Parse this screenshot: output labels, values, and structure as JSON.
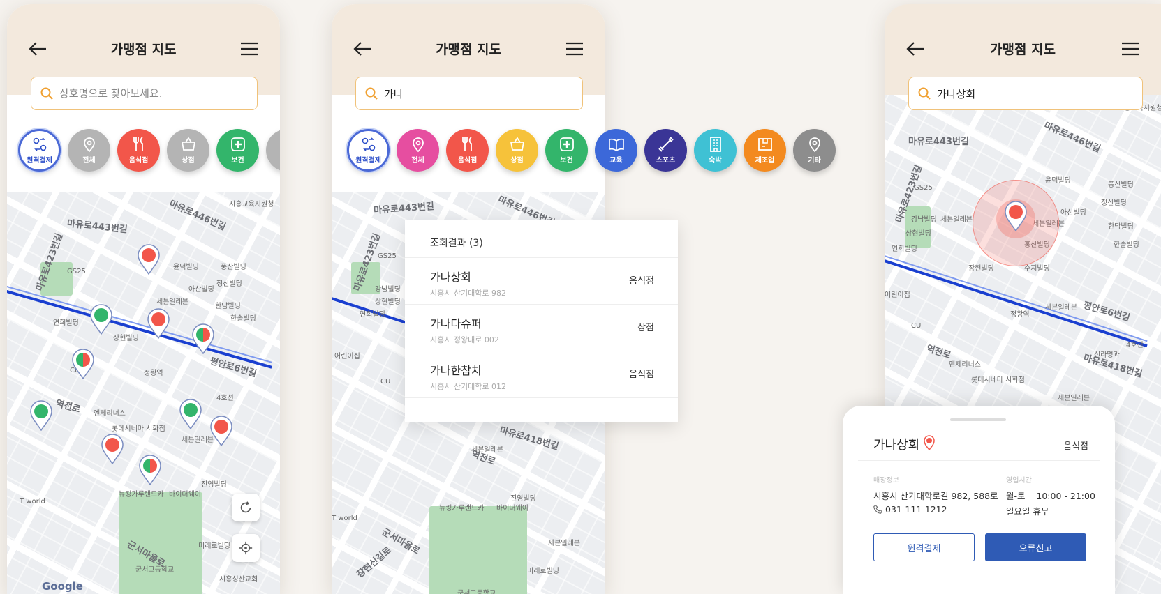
{
  "app": {
    "title": "가맹점 지도",
    "search_placeholder": "상호명으로 찾아보세요.",
    "search_query_results": "가나",
    "search_query_selected": "가나상회"
  },
  "categories": [
    {
      "label": "원격결제",
      "color": "#ffffff",
      "icon": "remote-payment-icon"
    },
    {
      "label": "전체",
      "color": "#b4b4b4",
      "icon": "location-pin-icon"
    },
    {
      "label": "음식점",
      "color": "#f2564a",
      "icon": "fork-knife-icon"
    },
    {
      "label": "상점",
      "color": "#f6c23a",
      "icon": "shopping-basket-icon"
    },
    {
      "label": "보건",
      "color": "#33b56b",
      "icon": "medical-plus-icon"
    },
    {
      "label": "교육",
      "color": "#3c68d9",
      "icon": "book-icon"
    },
    {
      "label": "스포츠",
      "color": "#3a3596",
      "icon": "dumbbell-icon"
    },
    {
      "label": "숙박",
      "color": "#3fc1d4",
      "icon": "hotel-icon"
    },
    {
      "label": "제조업",
      "color": "#f38a1f",
      "icon": "box-icon"
    },
    {
      "label": "기타",
      "color": "#8d8d8d",
      "icon": "map-pin-icon"
    }
  ],
  "map_labels": {
    "road_1": "마유로443번길",
    "road_2": "마유로446번길",
    "road_3": "평안로6번길",
    "road_4": "역전로",
    "road_5": "마유로423번길",
    "road_6": "마유로418번길",
    "road_7": "군서마을로",
    "road_8": "장현신길로",
    "store_gs25": "GS25",
    "store_cu": "CU",
    "seven": "세븐일레븐",
    "bldg_1": "윤덕빌딩",
    "bldg_2": "풍산빌딩",
    "bldg_3": "아산빌딩",
    "bldg_4": "정산빌딩",
    "bldg_5": "한담빌딩",
    "bldg_6": "한솔빌딩",
    "bldg_7": "강남빌딩",
    "bldg_8": "상현빌딩",
    "bldg_9": "연희빌딩",
    "bldg_10": "장현빌딩",
    "bldg_11": "수지빌딩",
    "bldg_12": "홍산빌딩",
    "station": "정왕역",
    "theater": "롯데시네마 시화점",
    "cafe": "엔제리너스",
    "sinrak": "신라명과",
    "school": "군서고등학교",
    "church": "시흥성산교회",
    "edu": "시흥교육지원청",
    "daycare": "어린이집",
    "tworld": "T world",
    "newcar": "뉴킹가루랜드카",
    "bike": "바이더웨이",
    "mirae": "미래로빌딩",
    "jinyoung": "진영빌딩",
    "line_4": "4호선",
    "google": "Google"
  },
  "results": {
    "header": "조회결과 (3)",
    "items": [
      {
        "name": "가나상회",
        "address": "시흥시 산기대학로 982",
        "category": "음식점"
      },
      {
        "name": "가나다슈퍼",
        "address": "시흥시 정왕대로 002",
        "category": "상점"
      },
      {
        "name": "가나한참치",
        "address": "시흥시 산기대학로 012",
        "category": "음식점"
      }
    ]
  },
  "detail": {
    "name": "가나상회",
    "category": "음식점",
    "store_info_label": "매장정보",
    "hours_label": "영업시간",
    "address": "시흥시 산기대학로길 982, 588로",
    "phone": "031-111-1212",
    "hours_weekday": "월-토    10:00 - 21:00",
    "hours_sunday": "일요일 휴무",
    "btn_remote": "원격결제",
    "btn_report": "오류신고"
  },
  "colors": {
    "header_bg": "#f3e9dd",
    "search_border": "#f0c27a",
    "route": "#1a3fd0",
    "primary_button": "#2f5bb5",
    "pin_red": "#f2564a",
    "pin_green": "#33b56b"
  }
}
